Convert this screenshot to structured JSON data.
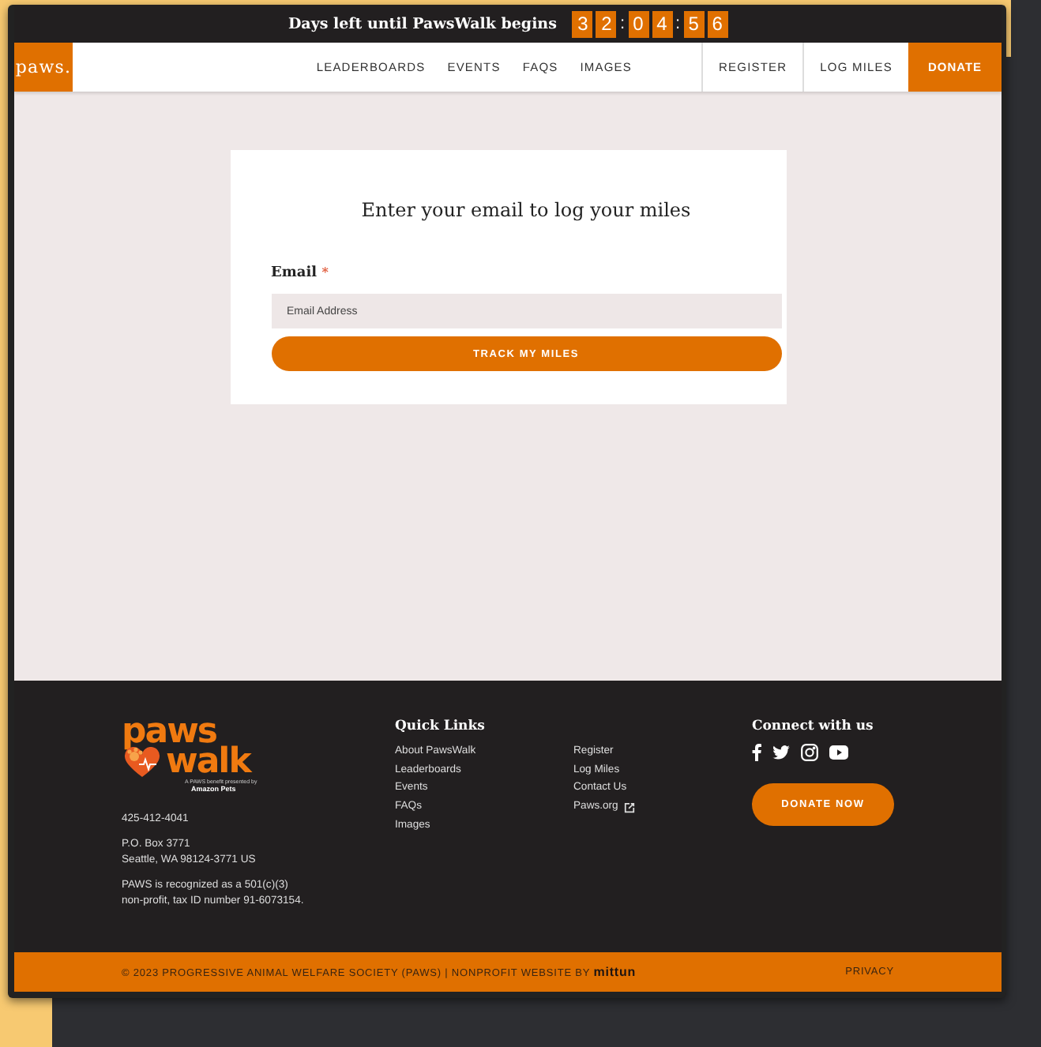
{
  "countdown": {
    "label": "Days left until PawsWalk begins",
    "groups": [
      [
        "3",
        "2"
      ],
      [
        "0",
        "4"
      ],
      [
        "5",
        "6"
      ]
    ],
    "separator": ":"
  },
  "nav": {
    "logo": "paws.",
    "links": [
      "LEADERBOARDS",
      "EVENTS",
      "FAQS",
      "IMAGES"
    ],
    "actions": [
      "REGISTER",
      "LOG MILES"
    ],
    "donate": "DONATE"
  },
  "form": {
    "title": "Enter your email to log your miles",
    "label": "Email",
    "required_mark": "*",
    "placeholder": "Email Address",
    "button": "TRACK MY MILES"
  },
  "footer": {
    "logo": {
      "line1": "paws",
      "line2": "walk",
      "tagline": "A PAWS benefit presented by",
      "sponsor": "Amazon Pets"
    },
    "phone": "425-412-4041",
    "address": [
      "P.O. Box 3771",
      "Seattle, WA 98124-3771 US"
    ],
    "note": [
      "PAWS is recognized as a 501(c)(3)",
      "non-profit, tax ID number 91-6073154."
    ],
    "quick_links": {
      "title": "Quick Links",
      "column_1": [
        "About PawsWalk",
        "Leaderboards",
        "Events",
        "FAQs",
        "Images"
      ],
      "column_2": [
        {
          "label": "Register",
          "external": false
        },
        {
          "label": "Log Miles",
          "external": false
        },
        {
          "label": "Contact Us",
          "external": false
        },
        {
          "label": "Paws.org",
          "external": true
        }
      ]
    },
    "connect": {
      "title": "Connect with us",
      "social": [
        {
          "kind": "facebook"
        },
        {
          "kind": "twitter"
        },
        {
          "kind": "instagram"
        },
        {
          "kind": "youtube"
        }
      ],
      "button": "DONATE NOW"
    }
  },
  "bottom_bar": {
    "copyright": "© 2023 PROGRESSIVE ANIMAL WELFARE SOCIETY (PAWS) | NONPROFIT WEBSITE BY **mittun**",
    "privacy": "PRIVACY"
  }
}
